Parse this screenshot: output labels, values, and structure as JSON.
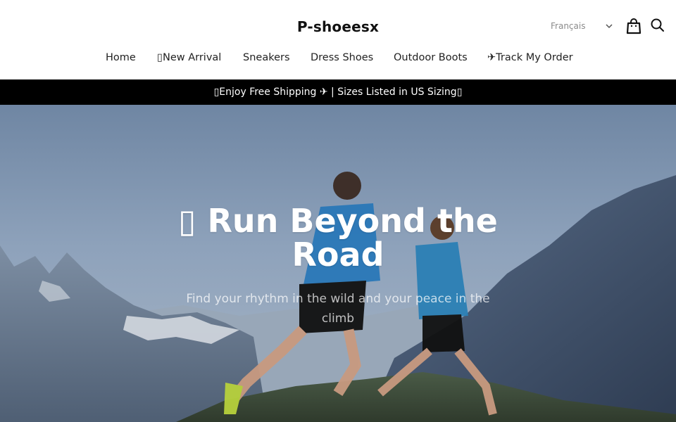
{
  "header": {
    "brand": "P-shoeesx",
    "language": {
      "selected": "Français"
    },
    "icons": {
      "cart": "shopping-bag-icon",
      "search": "search-icon"
    }
  },
  "nav": {
    "items": [
      {
        "label": "Home"
      },
      {
        "label": "New Arrival",
        "prefix_glyph": "▯"
      },
      {
        "label": "Sneakers"
      },
      {
        "label": "Dress Shoes"
      },
      {
        "label": "Outdoor Boots"
      },
      {
        "label": "Track My Order",
        "prefix_glyph": "✈"
      }
    ]
  },
  "announcement": {
    "text": "Enjoy Free Shipping ✈ | Sizes Listed in US Sizing",
    "prefix_glyph": "▯",
    "suffix_glyph": "▯"
  },
  "hero": {
    "title_glyph": "▯",
    "title": "Run Beyond the Road",
    "subtitle": "Find your rhythm in the wild and your peace in the climb"
  },
  "colors": {
    "announcement_bg": "#000000",
    "text": "#111111",
    "sky": "#7f93ad",
    "mountain": "#4b5d77"
  }
}
